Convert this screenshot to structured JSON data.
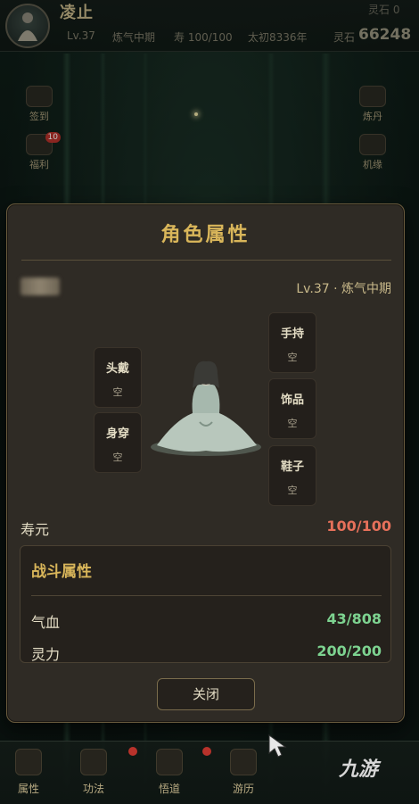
{
  "player": {
    "name": "凌止",
    "level": "Lv.37",
    "realm": "炼气中期",
    "lifespan_top": "寿 100/100",
    "era": "太初8336年",
    "stone_label": "灵石 0",
    "currency_label": "灵石",
    "currency_value": "66248"
  },
  "side_left": [
    {
      "label": "签到"
    },
    {
      "label": "福利",
      "badge": "10"
    }
  ],
  "side_right": [
    {
      "label": "炼丹"
    },
    {
      "label": "机缘"
    }
  ],
  "modal": {
    "title": "角色属性",
    "level_realm": "Lv.37 · 炼气中期",
    "slots": {
      "head": {
        "name": "头戴",
        "value": "空"
      },
      "body": {
        "name": "身穿",
        "value": "空"
      },
      "hand": {
        "name": "手持",
        "value": "空"
      },
      "accessory": {
        "name": "饰品",
        "value": "空"
      },
      "shoes": {
        "name": "鞋子",
        "value": "空"
      }
    },
    "lifespan": {
      "label": "寿元",
      "value": "100/100"
    },
    "combat": {
      "title": "战斗属性",
      "attrs": [
        {
          "label": "气血",
          "value": "43/808"
        },
        {
          "label": "灵力",
          "value": "200/200"
        }
      ]
    },
    "close_label": "关闭"
  },
  "bottom_nav": [
    {
      "label": "属性"
    },
    {
      "label": "功法"
    },
    {
      "label": "悟道"
    },
    {
      "label": "游历"
    }
  ],
  "watermark": "九游",
  "colors": {
    "gold": "#d9b65a",
    "hp_green": "#7dd390",
    "lifespan_red": "#e6705a",
    "badge_red": "#b8322b"
  }
}
